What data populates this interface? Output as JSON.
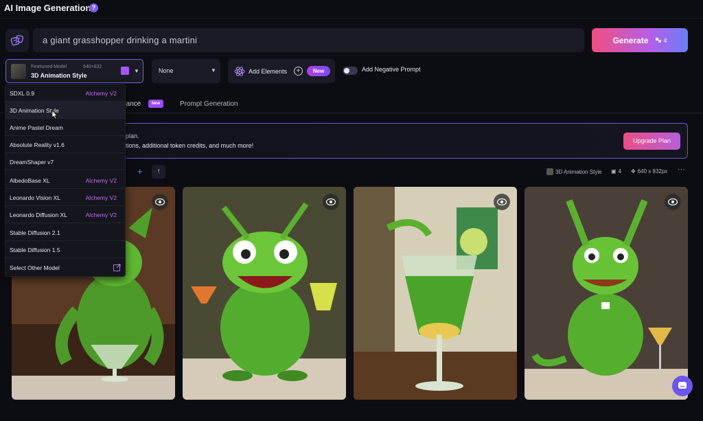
{
  "app": {
    "title": "AI Image Generation",
    "title_badge": "?"
  },
  "prompt": {
    "text": "a giant grasshopper drinking a martini"
  },
  "generate": {
    "label": "Generate",
    "count": "4"
  },
  "model": {
    "label": "Finetuned Model",
    "dims": "640×832",
    "name": "3D Animation Style"
  },
  "style_select": {
    "value": "None"
  },
  "add_elements": {
    "label": "Add Elements",
    "badge": "New"
  },
  "negative_prompt": {
    "label": "Add Negative Prompt",
    "enabled": false
  },
  "tabs": {
    "guidance": "dance",
    "guidance_badge": "New",
    "prompt_generation": "Prompt Generation"
  },
  "banner": {
    "line1": "plan.",
    "line2": "tions, additional token credits, and much more!",
    "button": "Upgrade Plan"
  },
  "toolbar": {
    "partial": "i",
    "plus": "+",
    "up": "↑",
    "style": "3D Animation Style",
    "count": "4",
    "dims": "640 x 832px",
    "more": "···"
  },
  "dropdown": {
    "items": [
      {
        "name": "SDXL 0.9",
        "tag": "Alchemy V2"
      },
      {
        "name": "3D Animation Style",
        "tag": ""
      },
      {
        "name": "Anime Pastel Dream",
        "tag": ""
      },
      {
        "name": "Absolute Reality v1.6",
        "tag": ""
      },
      {
        "name": "DreamShaper v7",
        "tag": ""
      },
      {
        "name": "AlbedoBase XL",
        "tag": "Alchemy V2"
      },
      {
        "name": "Leonardo Vision XL",
        "tag": "Alchemy V2"
      },
      {
        "name": "Leonardo Diffusion XL",
        "tag": "Alchemy V2"
      },
      {
        "name": "Stable Diffusion 2.1",
        "tag": ""
      },
      {
        "name": "Stable Diffusion 1.5",
        "tag": ""
      },
      {
        "name": "Select Other Model",
        "tag": ""
      }
    ]
  },
  "colors": {
    "accent": "#7b5cf0",
    "generate_start": "#ef4f7e",
    "generate_end": "#6b7dfa",
    "alchemy": "#c46ce8",
    "bg": "#0c0c13"
  }
}
